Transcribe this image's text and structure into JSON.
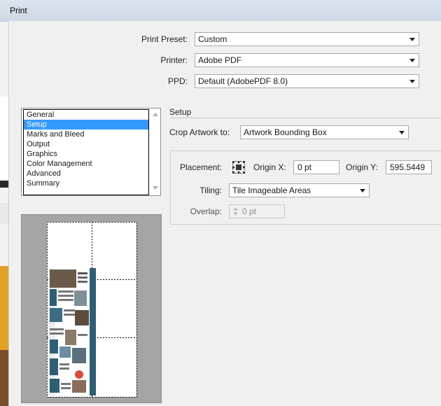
{
  "window": {
    "title": "Print"
  },
  "print_preset": {
    "label": "Print Preset:",
    "value": "Custom"
  },
  "printer": {
    "label": "Printer:",
    "value": "Adobe PDF"
  },
  "ppd": {
    "label": "PPD:",
    "value": "Default (AdobePDF 8.0)"
  },
  "categories": [
    {
      "label": "General",
      "selected": false
    },
    {
      "label": "Setup",
      "selected": true
    },
    {
      "label": "Marks and Bleed",
      "selected": false
    },
    {
      "label": "Output",
      "selected": false
    },
    {
      "label": "Graphics",
      "selected": false
    },
    {
      "label": "Color Management",
      "selected": false
    },
    {
      "label": "Advanced",
      "selected": false
    },
    {
      "label": "Summary",
      "selected": false
    }
  ],
  "setup": {
    "title": "Setup",
    "crop_label": "Crop Artwork to:",
    "crop_value": "Artwork Bounding Box",
    "placement_label": "Placement:",
    "origin_x_label": "Origin X:",
    "origin_x_value": "0 pt",
    "origin_y_label": "Origin Y:",
    "origin_y_value": "595.5449",
    "tiling_label": "Tiling:",
    "tiling_value": "Tile Imageable Areas",
    "overlap_label": "Overlap:",
    "overlap_value": "0 pt"
  },
  "colors": {
    "selection": "#3399ff",
    "preview_bg": "#a5a5a5",
    "brochure_accent": "#2d5f74"
  },
  "icons": [
    "placement-grid-icon",
    "dropdown-arrow-icon",
    "stepper-icon"
  ]
}
